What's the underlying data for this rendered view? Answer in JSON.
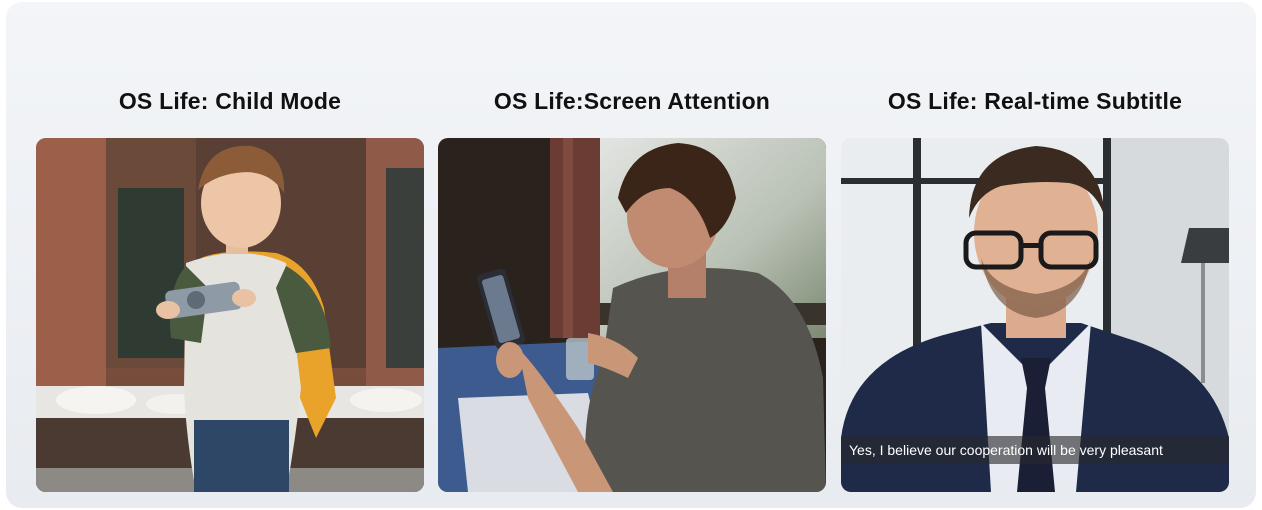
{
  "cards": [
    {
      "title": "OS Life: Child Mode",
      "image": "child-playing-phone-photo"
    },
    {
      "title": "OS Life:Screen Attention",
      "image": "man-using-phone-photo"
    },
    {
      "title": "OS Life: Real-time Subtitle",
      "image": "businessman-video-call-photo",
      "subtitle": "Yes, I believe our cooperation will be very pleasant"
    }
  ],
  "colors": {
    "title_text": "#111111",
    "panel_background": "#eef1f4",
    "subtitle_bar": "#3a3a40",
    "subtitle_text": "#ffffff"
  }
}
